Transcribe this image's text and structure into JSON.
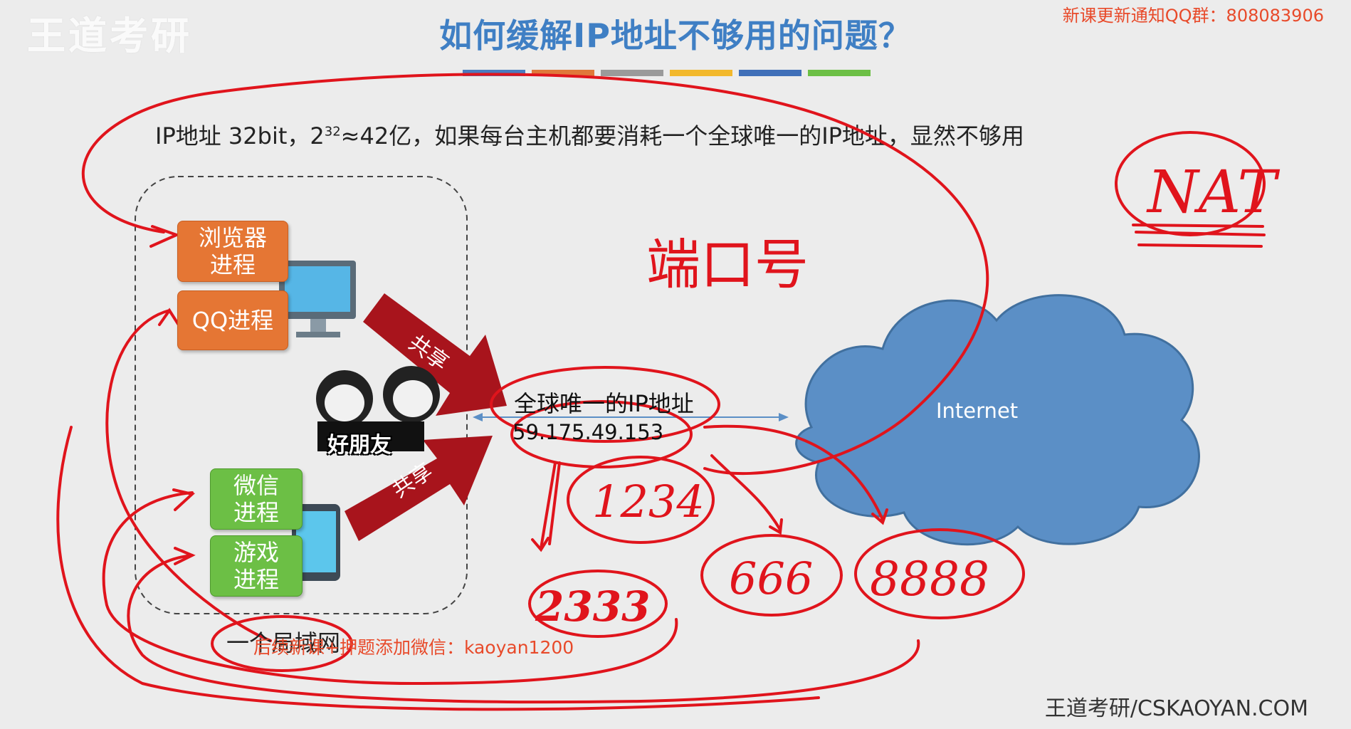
{
  "title": "如何缓解IP地址不够用的问题？",
  "top_right_notice": "新课更新通知QQ群：808083906",
  "watermark": "王道考研",
  "statement": {
    "prefix": "IP地址 32bit，2",
    "sup": "32",
    "suffix": "≈42亿，如果每台主机都要消耗一个全球唯一的IP地址，显然不够用"
  },
  "processes": [
    {
      "label": "浏览器\n进程"
    },
    {
      "label": "QQ进程"
    },
    {
      "label": "微信\n进程"
    },
    {
      "label": "游戏\n进程"
    }
  ],
  "share_label": "共享",
  "friends_label": "好朋友",
  "lan_label": "一个局域网",
  "wechat_notice": "后续新课+押题添加微信：kaoyan1200",
  "global_ip": {
    "label": "全球唯一的IP地址",
    "address": "59.175.49.153"
  },
  "cloud_label": "Internet",
  "handwriting": {
    "port": "端口号",
    "nat": "NAT",
    "ports": [
      "1234",
      "2333",
      "666",
      "8888"
    ]
  },
  "footer": "王道考研/CSKAOYAN.COM",
  "colors": {
    "title": "#3f7fc4",
    "ink": "#e0141c",
    "process_orange": "#e57634",
    "process_green": "#6cbf45",
    "cloud": "#5b8fc6"
  },
  "title_bar_colors": [
    "#4a7cc0",
    "#e0783a",
    "#9a9a9a",
    "#f2b82c",
    "#3f6fb8",
    "#6cbf45"
  ]
}
